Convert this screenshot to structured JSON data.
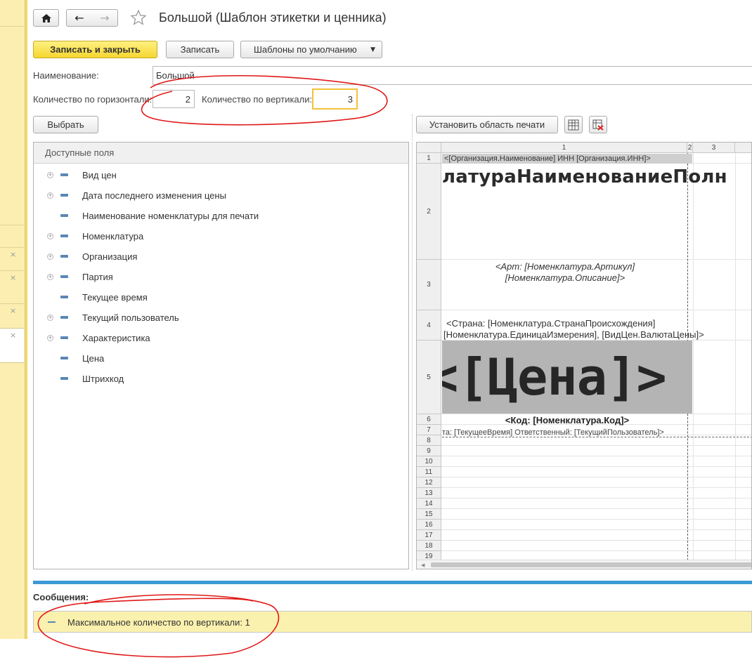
{
  "window": {
    "title": "Большой (Шаблон этикетки и ценника)"
  },
  "toolbar": {
    "save_close_label": "Записать и закрыть",
    "save_label": "Записать",
    "templates_label": "Шаблоны по умолчанию"
  },
  "form": {
    "name_label": "Наименование:",
    "name_value": "Большой",
    "horiz_label": "Количество по горизонтали:",
    "horiz_value": "2",
    "vert_label": "Количество по вертикали:",
    "vert_value": "3",
    "select_label": "Выбрать",
    "print_area_label": "Установить область печати"
  },
  "fields": {
    "header": "Доступные поля",
    "items": [
      {
        "label": "Вид цен",
        "expandable": true
      },
      {
        "label": "Дата последнего изменения цены",
        "expandable": true
      },
      {
        "label": "Наименование номенклатуры для печати",
        "expandable": false
      },
      {
        "label": "Номенклатура",
        "expandable": true
      },
      {
        "label": "Организация",
        "expandable": true
      },
      {
        "label": "Партия",
        "expandable": true
      },
      {
        "label": "Текущее время",
        "expandable": false
      },
      {
        "label": "Текущий пользователь",
        "expandable": true
      },
      {
        "label": "Характеристика",
        "expandable": true
      },
      {
        "label": "Цена",
        "expandable": false
      },
      {
        "label": "Штрихкод",
        "expandable": false
      }
    ]
  },
  "sheet": {
    "columns": [
      "1",
      "2",
      "3"
    ],
    "rows": [
      "1",
      "2",
      "3",
      "4",
      "5",
      "6",
      "7",
      "8",
      "9",
      "10",
      "11",
      "12",
      "13",
      "14",
      "15",
      "16",
      "17",
      "18",
      "19"
    ],
    "cells": {
      "r1": "<[Организация.Наименование] ИНН [Организация.ИНН]>",
      "r2": "латураНаименованиеПолн",
      "r3a": "<Арт: [Номенклатура.Артикул]",
      "r3b": "[Номенклатура.Описание]>",
      "r4a": "<Страна: [Номенклатура.СтранаПроисхождения]",
      "r4b": "[Номенклатура.ЕдиницаИзмерения], [ВидЦен.ВалютаЦены]>",
      "r5": "<[Цена]>",
      "r6": "<Код: [Номенклатура.Код]>",
      "r7": "та: [ТекущееВремя] Ответственный: [ТекущийПользователь]>"
    }
  },
  "messages": {
    "title": "Сообщения:",
    "text": "Максимальное количество по вертикали: 1"
  },
  "colors": {
    "accent_yellow": "#f5d631",
    "messages_bar": "#3d9ad6",
    "annotation_red": "#e01818"
  }
}
